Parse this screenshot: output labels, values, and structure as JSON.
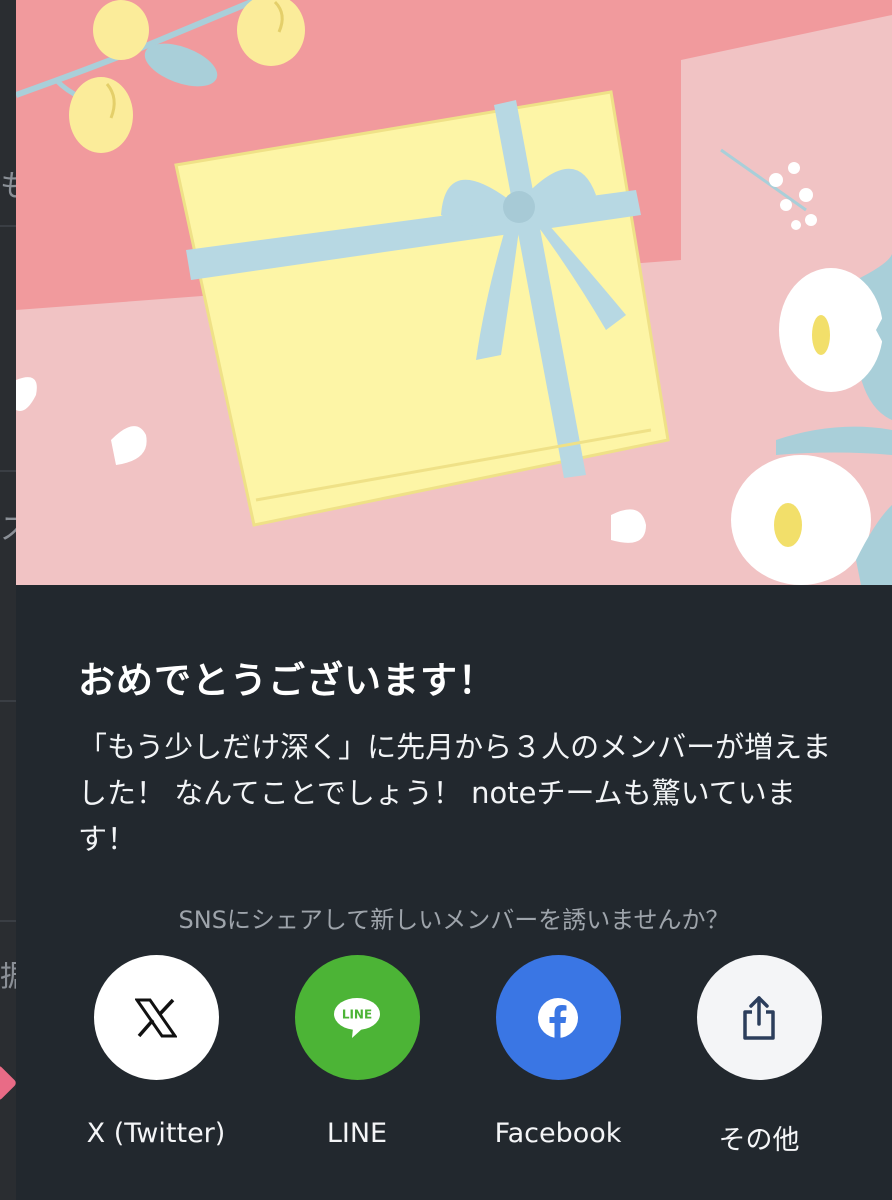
{
  "modal": {
    "title": "おめでとうございます！",
    "message": "「もう少しだけ深く」に先月から３人のメンバーが増えました！ なんてことでしょう！ noteチームも驚いています！",
    "share_prompt": "SNSにシェアして新しいメンバーを誘いませんか？"
  },
  "share": {
    "items": [
      {
        "label": "X (Twitter)",
        "icon": "x-logo-icon"
      },
      {
        "label": "LINE",
        "icon": "line-logo-icon",
        "badge_text": "LINE"
      },
      {
        "label": "Facebook",
        "icon": "facebook-logo-icon"
      },
      {
        "label": "その他",
        "icon": "share-icon"
      }
    ]
  },
  "colors": {
    "modal_bg": "#22282e",
    "line_green": "#4cb436",
    "facebook_blue": "#3a76e4",
    "hero_pink": "#f19a9d",
    "gift_yellow": "#fdf5a6",
    "ribbon_blue": "#b7d8e3"
  },
  "background": {
    "glyphs": [
      "も",
      "ス",
      "（",
      "据"
    ]
  }
}
